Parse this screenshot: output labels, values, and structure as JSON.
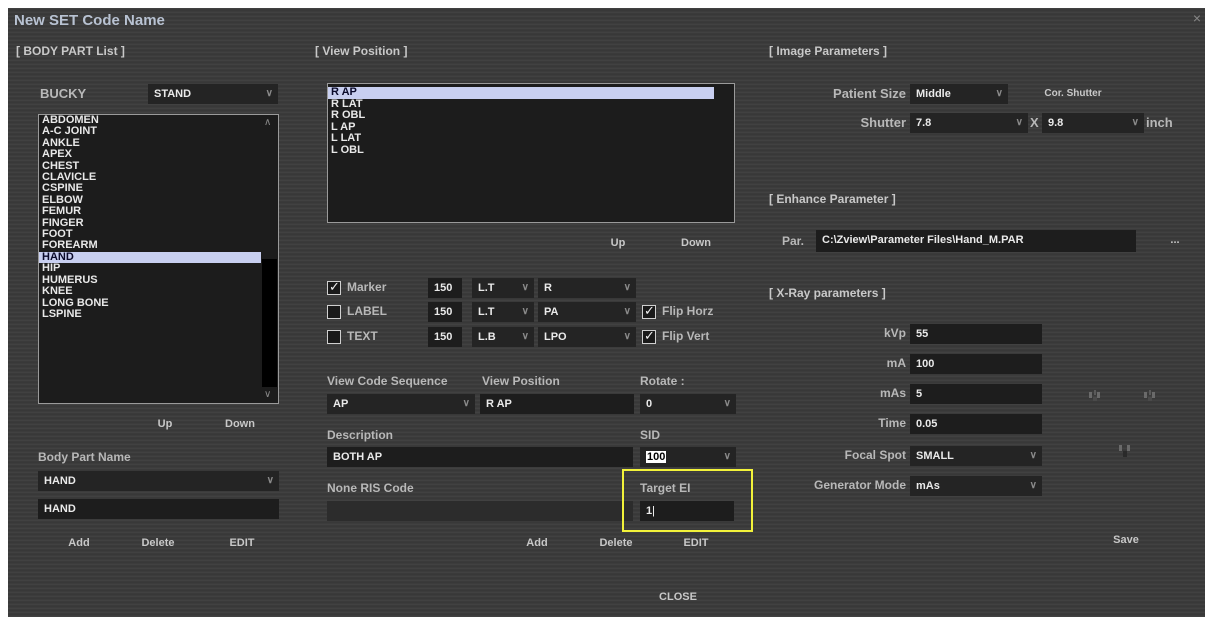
{
  "window": {
    "title": "New SET Code Name",
    "close_glyph": "×"
  },
  "body_part": {
    "section": "[ BODY PART List ]",
    "bucky_label": "BUCKY",
    "bucky_value": "STAND",
    "items": [
      "ABDOMEN",
      "A-C JOINT",
      "ANKLE",
      "APEX",
      "CHEST",
      "CLAVICLE",
      "CSPINE",
      "ELBOW",
      "FEMUR",
      "FINGER",
      "FOOT",
      "FOREARM",
      "HAND",
      "HIP",
      "HUMERUS",
      "KNEE",
      "LONG BONE",
      "LSPINE"
    ],
    "selected_index": 12,
    "up": "Up",
    "down": "Down",
    "name_label": "Body Part Name",
    "name_combo": "HAND",
    "name_field": "HAND",
    "add": "Add",
    "delete": "Delete",
    "edit": "EDIT"
  },
  "view_position": {
    "section": "[ View Position ]",
    "items": [
      "R AP",
      "R LAT",
      "R OBL",
      "L AP",
      "L LAT",
      "L OBL"
    ],
    "selected_index": 0,
    "up": "Up",
    "down": "Down",
    "marker": {
      "label": "Marker",
      "checked": true,
      "size": "150",
      "pos": "L.T",
      "text": "R"
    },
    "label_row": {
      "label": "LABEL",
      "checked": false,
      "size": "150",
      "pos": "L.T",
      "text": "PA"
    },
    "text_row": {
      "label": "TEXT",
      "checked": false,
      "size": "150",
      "pos": "L.B",
      "text": "LPO"
    },
    "flip_horz": {
      "label": "Flip Horz",
      "checked": true
    },
    "flip_vert": {
      "label": "Flip Vert",
      "checked": true
    },
    "view_code_label": "View Code Sequence",
    "view_code_value": "AP",
    "view_pos_label": "View Position",
    "view_pos_value": "R AP",
    "rotate_label": "Rotate :",
    "rotate_value": "0",
    "description_label": "Description",
    "description_value": "BOTH AP",
    "sid_label": "SID",
    "sid_value": "100",
    "none_ris_label": "None RIS Code",
    "none_ris_value": "",
    "target_ei_label": "Target EI",
    "target_ei_value": "1",
    "add": "Add",
    "delete": "Delete",
    "edit": "EDIT"
  },
  "image_params": {
    "section": "[ Image Parameters ]",
    "patient_size_label": "Patient Size",
    "patient_size_value": "Middle",
    "cor_shutter": "Cor. Shutter",
    "shutter_label": "Shutter",
    "shutter_w": "7.8",
    "x_sep": "X",
    "shutter_h": "9.8",
    "unit": "inch"
  },
  "enhance": {
    "section": "[ Enhance Parameter ]",
    "par_label": "Par.",
    "par_value": "C:\\Zview\\Parameter Files\\Hand_M.PAR",
    "browse": "..."
  },
  "xray": {
    "section": "[ X-Ray parameters ]",
    "kvp_label": "kVp",
    "kvp_value": "55",
    "ma_label": "mA",
    "ma_value": "100",
    "mas_label": "mAs",
    "mas_value": "5",
    "time_label": "Time",
    "time_value": "0.05",
    "focal_label": "Focal Spot",
    "focal_value": "SMALL",
    "gen_label": "Generator Mode",
    "gen_value": "mAs"
  },
  "save": "Save",
  "close": "CLOSE",
  "colors": {
    "highlight": "#f2f23a",
    "selection": "#c8cff0",
    "background": "#3a3a3a"
  }
}
